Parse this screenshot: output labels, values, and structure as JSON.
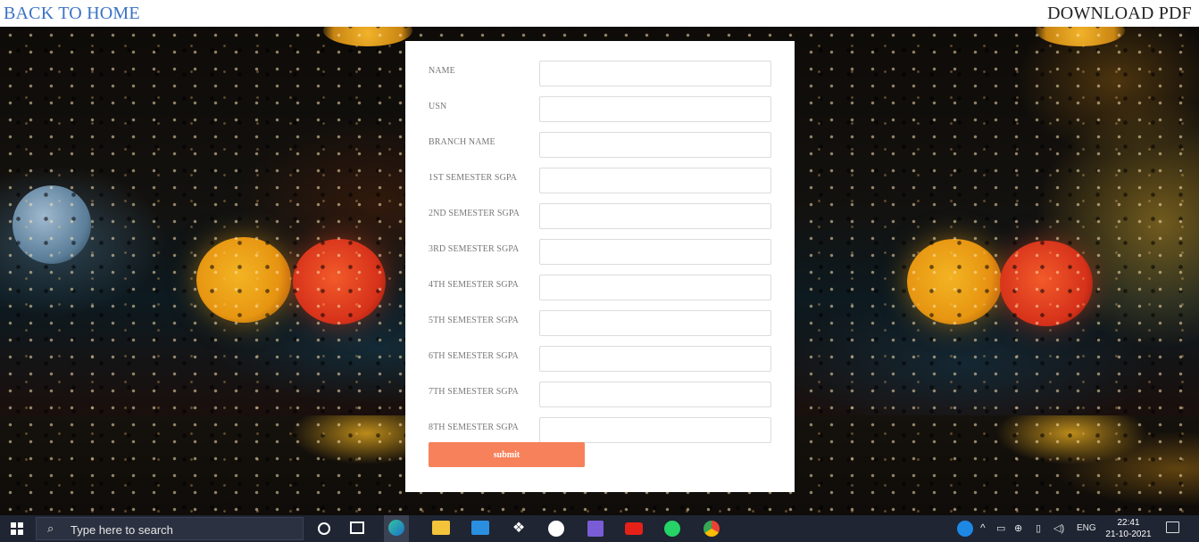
{
  "topbar": {
    "back_label": "BACK TO HOME",
    "download_label": "DOWNLOAD PDF"
  },
  "form": {
    "fields": [
      {
        "label": "NAME",
        "value": ""
      },
      {
        "label": "USN",
        "value": ""
      },
      {
        "label": "BRANCH NAME",
        "value": ""
      },
      {
        "label": "1ST SEMESTER SGPA",
        "value": ""
      },
      {
        "label": "2ND SEMESTER SGPA",
        "value": ""
      },
      {
        "label": "3RD SEMESTER SGPA",
        "value": ""
      },
      {
        "label": "4TH SEMESTER SGPA",
        "value": ""
      },
      {
        "label": "5TH SEMESTER SGPA",
        "value": ""
      },
      {
        "label": "6TH SEMESTER SGPA",
        "value": ""
      },
      {
        "label": "7TH SEMESTER SGPA",
        "value": ""
      },
      {
        "label": "8TH SEMESTER SGPA",
        "value": ""
      }
    ],
    "submit_label": "submit",
    "submit_color": "#f7815b"
  },
  "taskbar": {
    "search_placeholder": "Type here to search",
    "language": "ENG",
    "time": "22:41",
    "date": "21-10-2021",
    "apps": [
      "cortana-icon",
      "task-view-icon",
      "edge-icon",
      "file-explorer-icon",
      "mail-icon",
      "dropbox-icon",
      "github-icon",
      "power-automate-icon",
      "youtube-icon",
      "whatsapp-icon",
      "chrome-icon"
    ]
  },
  "colors": {
    "link_blue": "#3b73c4",
    "taskbar_bg": "#1f2533"
  }
}
